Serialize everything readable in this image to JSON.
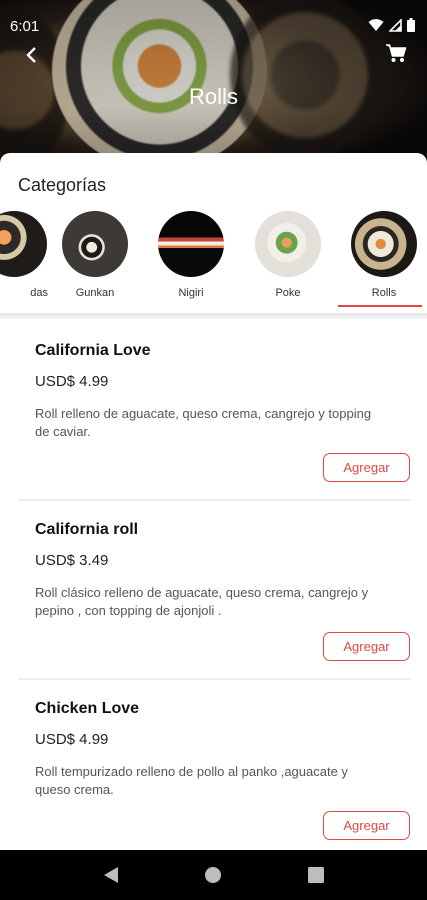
{
  "status_bar": {
    "time": "6:01"
  },
  "header": {
    "title": "Rolls",
    "back_icon": "chevron-left-icon",
    "cart_icon": "shopping-cart-icon"
  },
  "categories_section": {
    "heading": "Categorías",
    "items": [
      {
        "label": "das",
        "active": false
      },
      {
        "label": "Gunkan",
        "active": false
      },
      {
        "label": "Nigiri",
        "active": false
      },
      {
        "label": "Poke",
        "active": false
      },
      {
        "label": "Rolls",
        "active": true
      }
    ],
    "accent_color": "#e04848"
  },
  "products": [
    {
      "name": "California Love",
      "price": "USD$ 4.99",
      "description": "Roll relleno de aguacate, queso crema, cangrejo y topping de caviar.",
      "button": "Agregar"
    },
    {
      "name": "California roll",
      "price": "USD$ 3.49",
      "description": "Roll clásico  relleno de aguacate, queso crema, cangrejo y pepino , con topping de ajonjoli .",
      "button": "Agregar"
    },
    {
      "name": "Chicken Love",
      "price": "USD$ 4.99",
      "description": "Roll tempurizado relleno de pollo al panko ,aguacate y queso crema.",
      "button": "Agregar"
    }
  ],
  "nav_bar": {
    "back": "triangle-back-icon",
    "home": "circle-home-icon",
    "recents": "square-recents-icon"
  }
}
